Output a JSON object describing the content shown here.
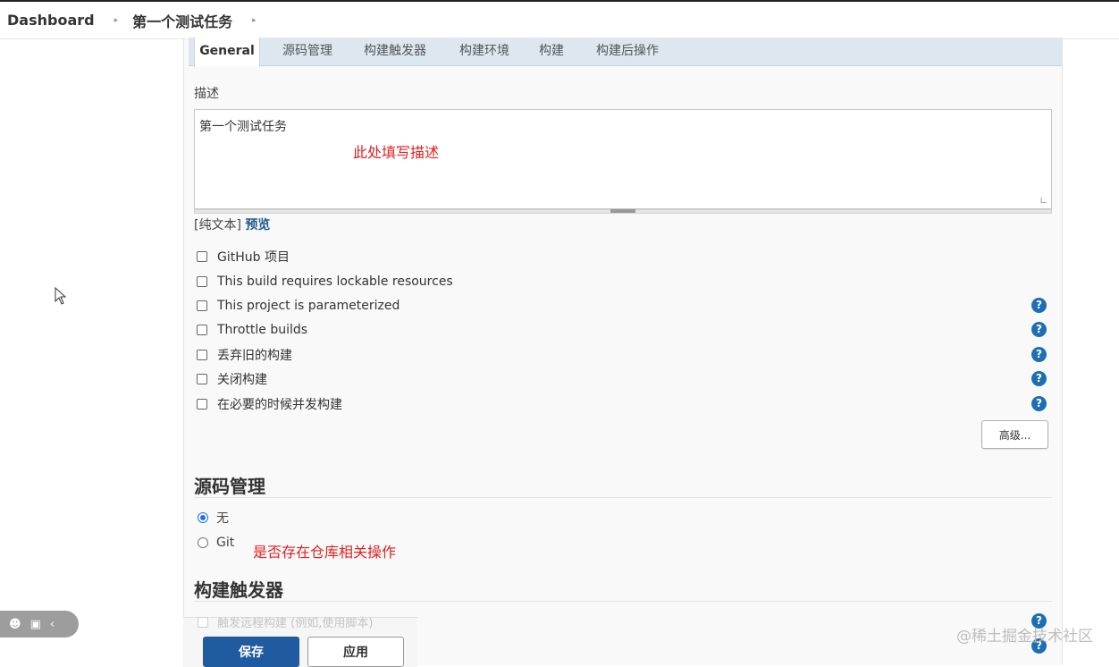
{
  "breadcrumb": {
    "root": "Dashboard",
    "job": "第一个测试任务"
  },
  "tabs": [
    "General",
    "源码管理",
    "构建触发器",
    "构建环境",
    "构建",
    "构建后操作"
  ],
  "active_tab": "General",
  "description": {
    "label": "描述",
    "value": "第一个测试任务",
    "format_plain": "[纯文本]",
    "format_preview": "预览"
  },
  "annotations": {
    "desc_note": "此处填写描述",
    "scm_note": "是否存在仓库相关操作"
  },
  "options": [
    {
      "label": "GitHub 项目",
      "checked": false,
      "help": false
    },
    {
      "label": "This build requires lockable resources",
      "checked": false,
      "help": false
    },
    {
      "label": "This project is parameterized",
      "checked": false,
      "help": true
    },
    {
      "label": "Throttle builds",
      "checked": false,
      "help": true
    },
    {
      "label": "丢弃旧的构建",
      "checked": false,
      "help": true
    },
    {
      "label": "关闭构建",
      "checked": false,
      "help": true
    },
    {
      "label": "在必要的时候并发构建",
      "checked": false,
      "help": true
    }
  ],
  "help_glyph": "?",
  "advanced_button": "高级...",
  "scm": {
    "title": "源码管理",
    "options": [
      {
        "label": "无",
        "selected": true
      },
      {
        "label": "Git",
        "selected": false
      }
    ]
  },
  "triggers": {
    "title": "构建触发器",
    "first_option": "触发远程构建 (例如,使用脚本)"
  },
  "actions": {
    "save": "保存",
    "apply": "应用"
  },
  "watermark": "@稀土掘金技术社区",
  "colors": {
    "accent_blue": "#1f5b9e",
    "help_blue": "#1c6fb5",
    "annotation_red": "#e02020",
    "tab_bar": "#dde7f0"
  }
}
